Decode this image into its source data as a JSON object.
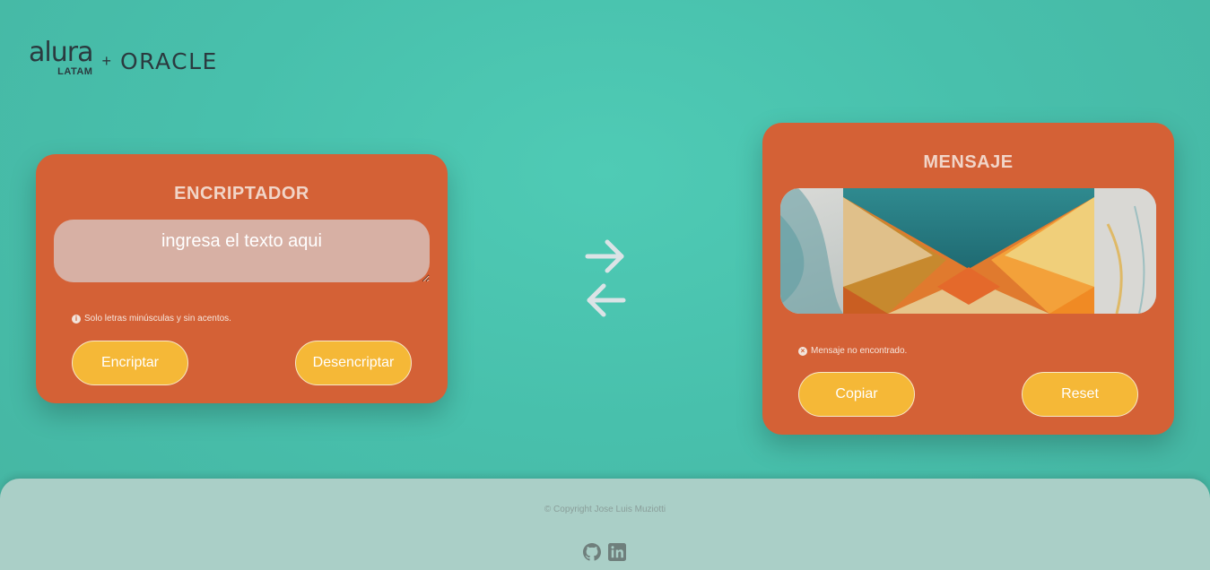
{
  "header": {
    "logo_alura": "alura",
    "logo_latam": "LATAM",
    "logo_plus": "+",
    "logo_oracle": "ORACLE"
  },
  "encryptor": {
    "title": "ENCRIPTADOR",
    "input_placeholder": "ingresa el texto aqui",
    "hint_icon": "i",
    "hint": "Solo letras minúsculas y sin acentos.",
    "encrypt_label": "Encriptar",
    "decrypt_label": "Desencriptar"
  },
  "swap": {
    "icon": "swap-arrows-icon"
  },
  "output": {
    "title": "MENSAJE",
    "status_icon": "×",
    "status": "Mensaje no encontrado.",
    "copy_label": "Copiar",
    "reset_label": "Reset"
  },
  "footer": {
    "copyright": "© Copyright Jose Luis Muziotti",
    "links": [
      "github-icon",
      "linkedin-icon"
    ]
  },
  "colors": {
    "background": "#4fcbb5",
    "card": "#d46136",
    "button": "#f5b837",
    "footer": "#aacfc7"
  }
}
